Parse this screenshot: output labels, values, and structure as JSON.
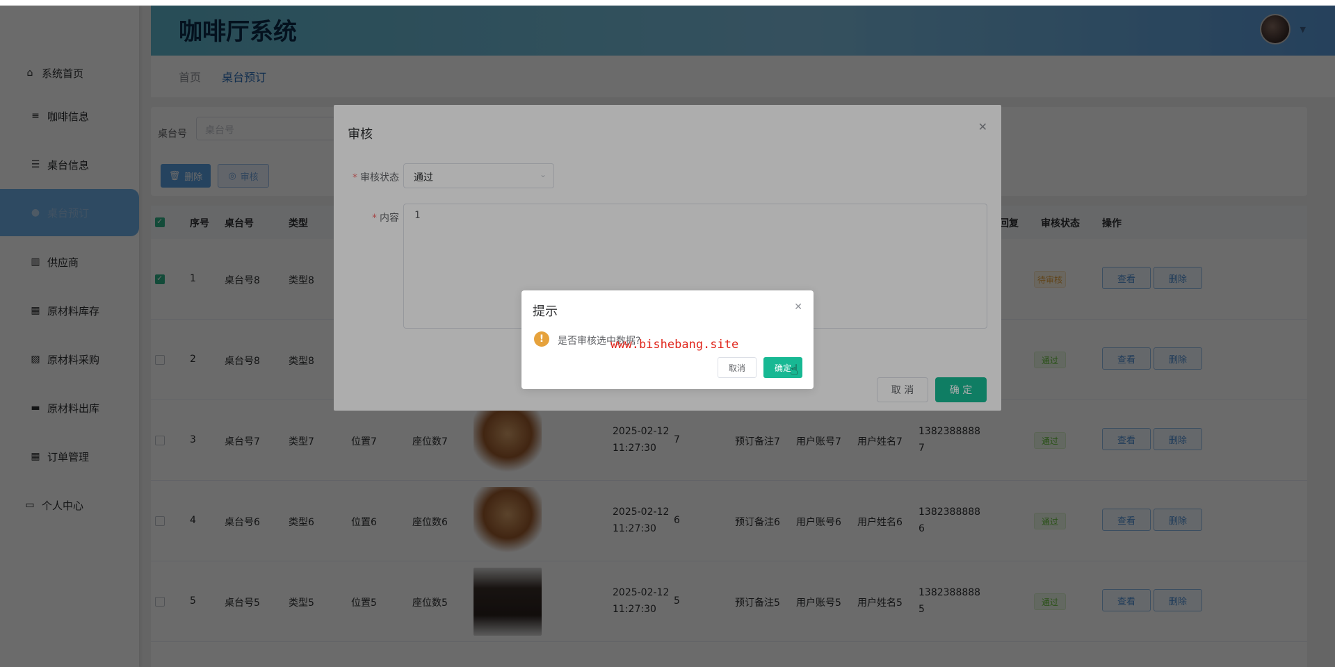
{
  "app": {
    "title": "咖啡厅系统"
  },
  "sidebar": {
    "items": [
      {
        "label": "系统首页",
        "icon": "home-icon"
      },
      {
        "label": "咖啡信息",
        "icon": "list-icon"
      },
      {
        "label": "桌台信息",
        "icon": "sliders-icon"
      },
      {
        "label": "桌台预订",
        "icon": "user-icon",
        "active": true
      },
      {
        "label": "供应商",
        "icon": "books-icon"
      },
      {
        "label": "原材料库存",
        "icon": "grid-icon"
      },
      {
        "label": "原材料采购",
        "icon": "chart-icon"
      },
      {
        "label": "原材料出库",
        "icon": "chat-icon"
      },
      {
        "label": "订单管理",
        "icon": "grid-icon"
      },
      {
        "label": "个人中心",
        "icon": "card-icon"
      }
    ]
  },
  "breadcrumb": {
    "home": "首页",
    "current": "桌台预订"
  },
  "search": {
    "label": "桌台号",
    "placeholder": "桌台号"
  },
  "toolbar": {
    "delete_label": "删除",
    "audit_label": "审核"
  },
  "table": {
    "headers": {
      "seq": "序号",
      "table_no": "桌台号",
      "type": "类型",
      "reply": "回复",
      "audit_status": "审核状态",
      "ops": "操作"
    },
    "view_label": "查看",
    "delete_label": "删除",
    "rows": [
      {
        "seq": "1",
        "table_no": "桌台号8",
        "type": "类型8",
        "position": "",
        "seats": "",
        "date": "",
        "time": "",
        "count": "",
        "note": "",
        "account": "",
        "name": "",
        "phone1": "",
        "phone2": "",
        "status": "待审核",
        "checked": true
      },
      {
        "seq": "2",
        "table_no": "桌台号8",
        "type": "类型8",
        "position": "",
        "seats": "",
        "date": "",
        "time": "",
        "count": "",
        "note": "",
        "account": "",
        "name": "",
        "phone1": "",
        "phone2": "",
        "status": "通过",
        "checked": false
      },
      {
        "seq": "3",
        "table_no": "桌台号7",
        "type": "类型7",
        "position": "位置7",
        "seats": "座位数7",
        "date": "2025-02-12",
        "time": "11:27:30",
        "count": "7",
        "note": "预订备注7",
        "account": "用户账号7",
        "name": "用户姓名7",
        "phone1": "1382388888",
        "phone2": "7",
        "status": "通过",
        "checked": false
      },
      {
        "seq": "4",
        "table_no": "桌台号6",
        "type": "类型6",
        "position": "位置6",
        "seats": "座位数6",
        "date": "2025-02-12",
        "time": "11:27:30",
        "count": "6",
        "note": "预订备注6",
        "account": "用户账号6",
        "name": "用户姓名6",
        "phone1": "1382388888",
        "phone2": "6",
        "status": "通过",
        "checked": false
      },
      {
        "seq": "5",
        "table_no": "桌台号5",
        "type": "类型5",
        "position": "位置5",
        "seats": "座位数5",
        "date": "2025-02-12",
        "time": "11:27:30",
        "count": "5",
        "note": "预订备注5",
        "account": "用户账号5",
        "name": "用户姓名5",
        "phone1": "1382388888",
        "phone2": "5",
        "status": "通过",
        "checked": false
      }
    ]
  },
  "dialog": {
    "title": "审核",
    "status_label": "审核状态",
    "status_value": "通过",
    "content_label": "内容",
    "content_value": "1",
    "cancel_label": "取 消",
    "ok_label": "确 定"
  },
  "messagebox": {
    "title": "提示",
    "message": "是否审核选中数据?",
    "cancel_label": "取消",
    "ok_label": "确定"
  },
  "watermark": "www.bishebang.site",
  "colors": {
    "accent": "#17b893",
    "primary": "#5aa0e2",
    "warning": "#e6a23c",
    "success": "#67c23a"
  }
}
